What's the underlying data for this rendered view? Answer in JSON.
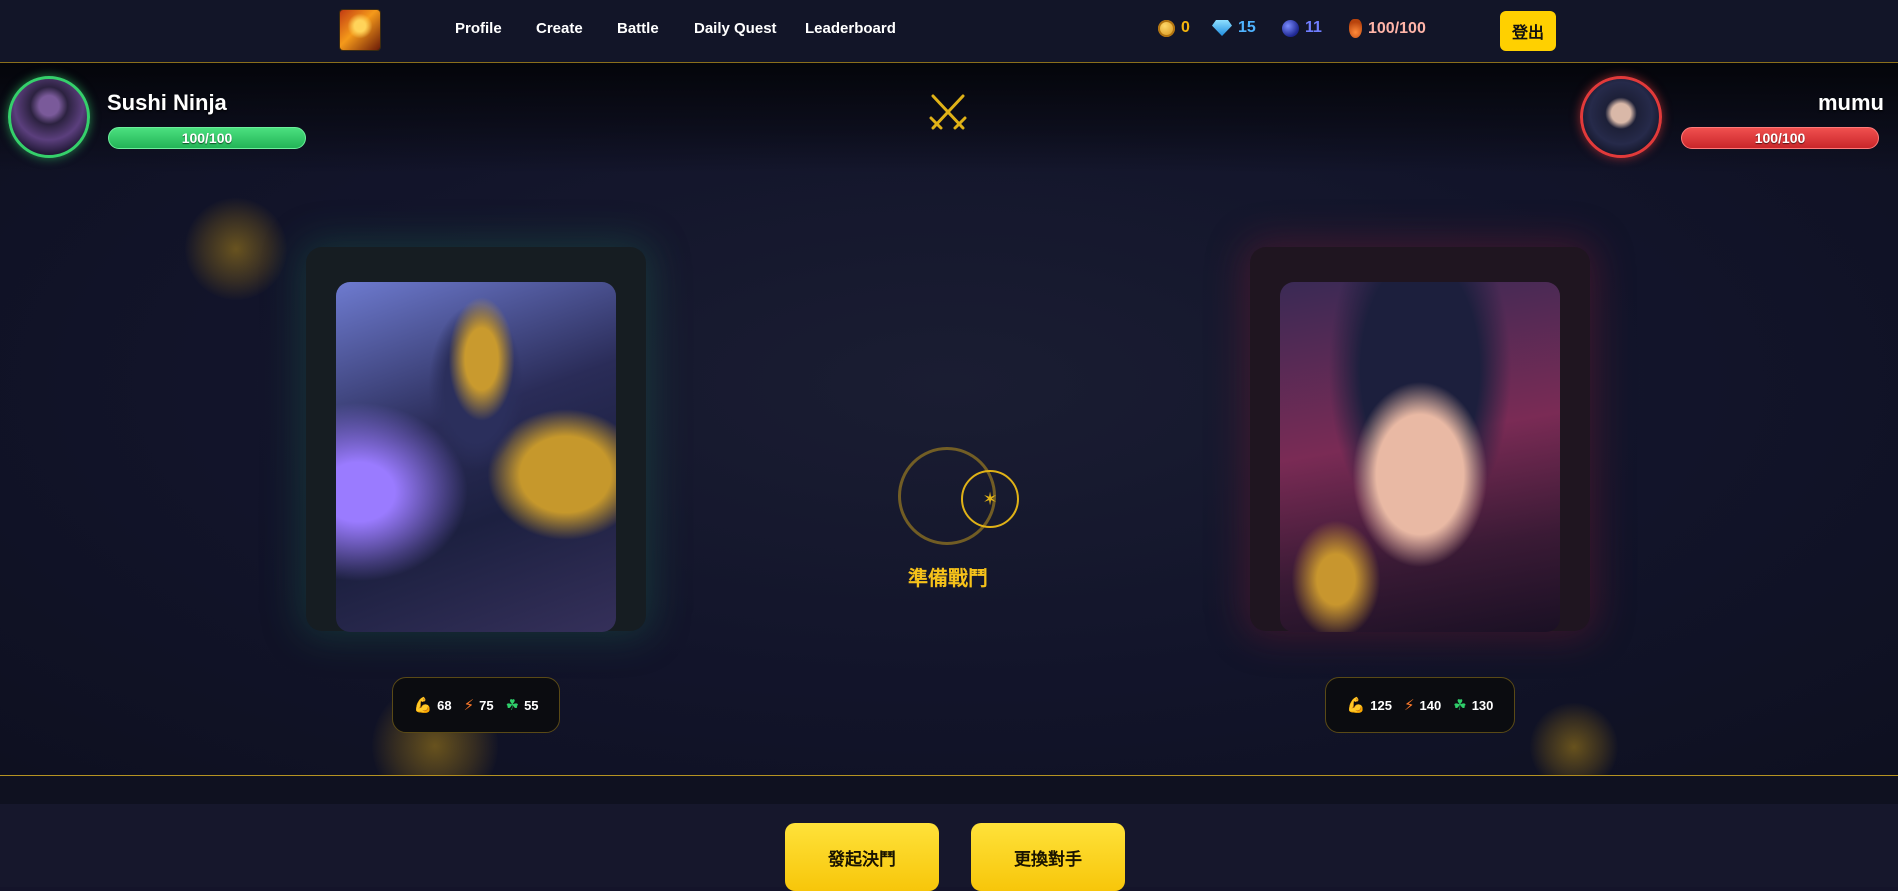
{
  "nav": {
    "links": [
      "Profile",
      "Create",
      "Battle",
      "Daily Quest",
      "Leaderboard"
    ],
    "resources": {
      "coins": "0",
      "gems": "15",
      "orbs": "11",
      "energy": "100/100"
    },
    "logout_label": "登出",
    "colors": {
      "coins": "#f5b50e",
      "gems": "#4fb3ff",
      "orbs": "#6f7dff",
      "energy": "#ffb4a8"
    }
  },
  "player": {
    "name": "Sushi Ninja",
    "hp": "100/100",
    "hp_fraction": 1.0,
    "stats": {
      "strength": "68",
      "speed": "75",
      "luck": "55"
    }
  },
  "opponent": {
    "name": "mumu",
    "hp": "100/100",
    "hp_fraction": 1.0,
    "stats": {
      "strength": "125",
      "speed": "140",
      "luck": "130"
    }
  },
  "center": {
    "status_text": "準備戰鬥",
    "icon": "crossed-swords-icon"
  },
  "actions": {
    "duel_label": "發起決鬥",
    "change_label": "更換對手"
  },
  "accent_color": "#ffd000"
}
